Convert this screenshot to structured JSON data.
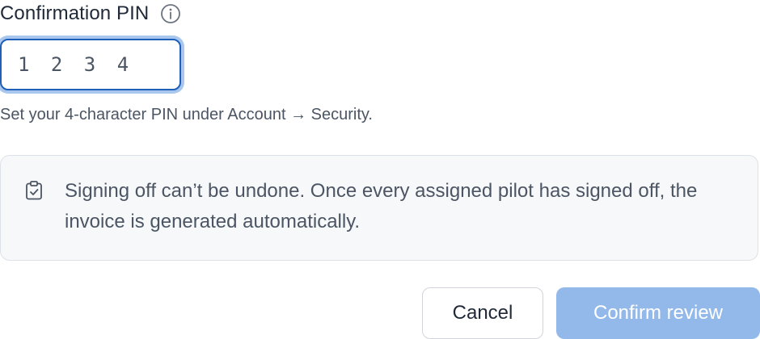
{
  "pin_field": {
    "label": "Confirmation PIN",
    "info_icon": "info-icon",
    "value": "1 2 3 4",
    "help_text": "Set your 4-character PIN under Account → Security."
  },
  "notice": {
    "icon": "clipboard-check-icon",
    "text": "Signing off can’t be undone. Once every assigned pilot has signed off, the invoice is generated automatically."
  },
  "actions": {
    "cancel_label": "Cancel",
    "confirm_label": "Confirm review",
    "confirm_color": "#93b9ea"
  },
  "colors": {
    "focus_border": "#1e5fb8",
    "focus_ring": "#a9c6ee",
    "notice_bg": "#f6f8fa"
  }
}
